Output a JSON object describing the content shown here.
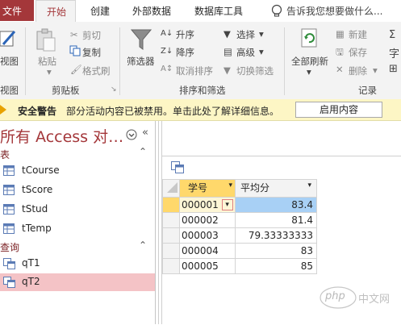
{
  "tabs": {
    "file": "文件",
    "home": "开始",
    "create": "创建",
    "external": "外部数据",
    "dbtools": "数据库工具",
    "tellme": "告诉我您想要做什么..."
  },
  "ribbon": {
    "views": {
      "label": "视图",
      "group": "视图"
    },
    "clipboard": {
      "paste": "粘贴",
      "cut": "剪切",
      "copy": "复制",
      "format_painter": "格式刷",
      "group": "剪贴板"
    },
    "sort_filter": {
      "filter": "筛选器",
      "asc": "升序",
      "desc": "降序",
      "clear_sort": "取消排序",
      "selection": "选择",
      "advanced": "高级",
      "toggle_filter": "切换筛选",
      "group": "排序和筛选"
    },
    "records": {
      "refresh_all": "全部刷新",
      "new": "新建",
      "save": "保存",
      "delete": "删除",
      "group": "记录"
    }
  },
  "security": {
    "title": "安全警告",
    "message": "部分活动内容已被禁用。单击此处了解详细信息。",
    "button": "启用内容"
  },
  "nav": {
    "title": "所有 Access 对…",
    "tables_header": "表",
    "tables": [
      "tCourse",
      "tScore",
      "tStud",
      "tTemp"
    ],
    "queries_header": "查询",
    "queries": [
      "qT1",
      "qT2"
    ],
    "selected": "qT2"
  },
  "datasheet": {
    "columns": [
      "学号",
      "平均分"
    ],
    "rows": [
      [
        "000001",
        "83.4"
      ],
      [
        "000002",
        "81.4"
      ],
      [
        "000003",
        "79.33333333"
      ],
      [
        "000004",
        "83"
      ],
      [
        "000005",
        "85"
      ]
    ]
  },
  "watermark": {
    "text1": "php",
    "text2": "中文网"
  },
  "colors": {
    "accent": "#a4373a",
    "selection": "#f4c3c6",
    "header_highlight": "#ffd86b",
    "cell_highlight": "#a8d0f5",
    "security_bar": "#fdf6c5"
  }
}
